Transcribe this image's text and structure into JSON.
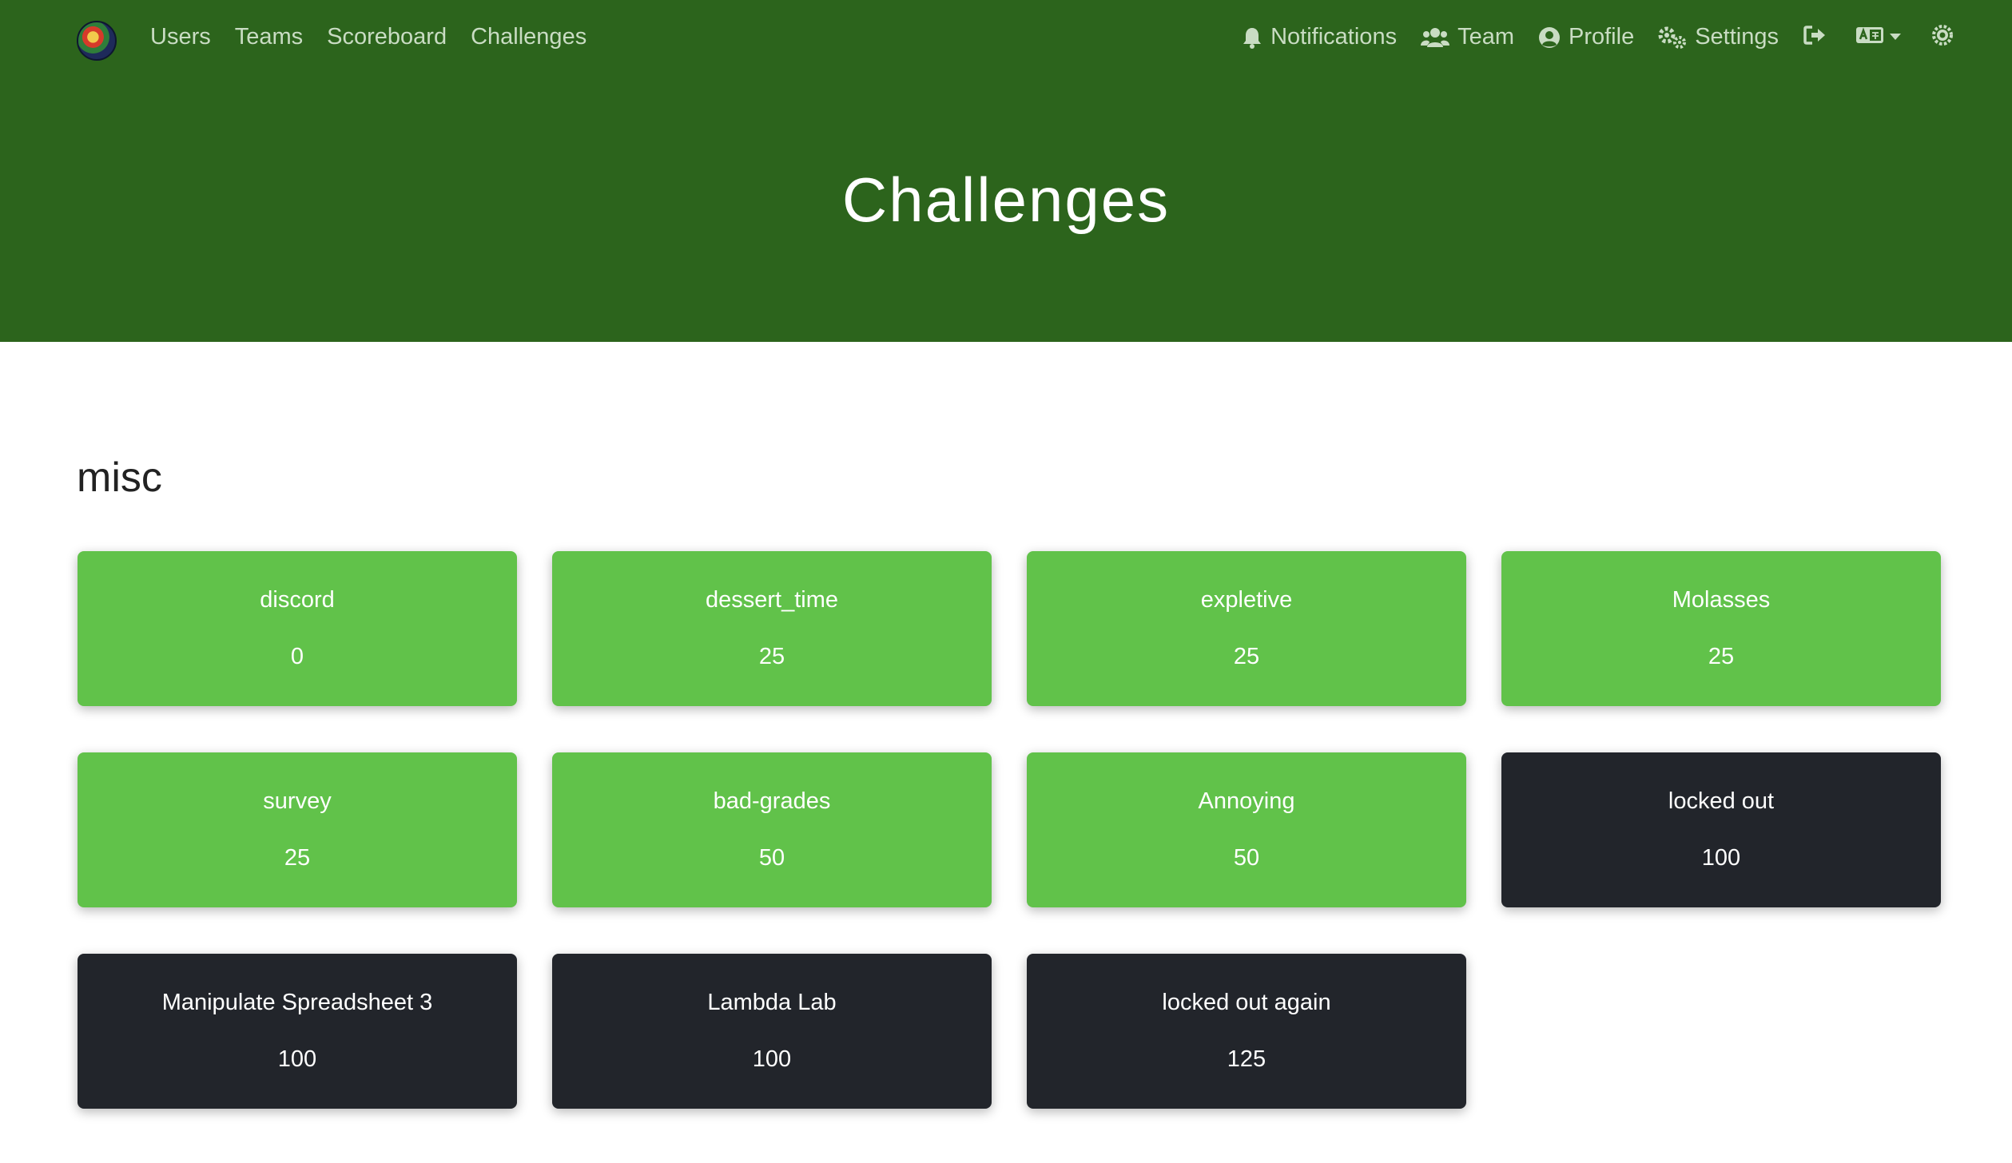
{
  "nav": {
    "left_links": [
      {
        "label": "Users"
      },
      {
        "label": "Teams"
      },
      {
        "label": "Scoreboard"
      },
      {
        "label": "Challenges"
      }
    ],
    "right": {
      "notifications": "Notifications",
      "team": "Team",
      "profile": "Profile",
      "settings": "Settings"
    }
  },
  "jumbotron": {
    "title": "Challenges"
  },
  "category": {
    "name": "misc",
    "challenges": [
      {
        "name": "discord",
        "value": "0",
        "state": "solved"
      },
      {
        "name": "dessert_time",
        "value": "25",
        "state": "solved"
      },
      {
        "name": "expletive",
        "value": "25",
        "state": "solved"
      },
      {
        "name": "Molasses",
        "value": "25",
        "state": "solved"
      },
      {
        "name": "survey",
        "value": "25",
        "state": "solved"
      },
      {
        "name": "bad-grades",
        "value": "50",
        "state": "solved"
      },
      {
        "name": "Annoying",
        "value": "50",
        "state": "solved"
      },
      {
        "name": "locked out",
        "value": "100",
        "state": "locked"
      },
      {
        "name": "Manipulate Spreadsheet 3",
        "value": "100",
        "state": "locked"
      },
      {
        "name": "Lambda Lab",
        "value": "100",
        "state": "locked"
      },
      {
        "name": "locked out again",
        "value": "125",
        "state": "locked"
      }
    ]
  },
  "colors": {
    "navbar_bg": "#2c641c",
    "solved_bg": "#61c24a",
    "locked_bg": "#22252b"
  },
  "icons": [
    "bell-icon",
    "users-icon",
    "user-circle-icon",
    "cogs-icon",
    "sign-out-icon",
    "language-icon",
    "caret-down-icon",
    "theme-toggle-icon"
  ]
}
